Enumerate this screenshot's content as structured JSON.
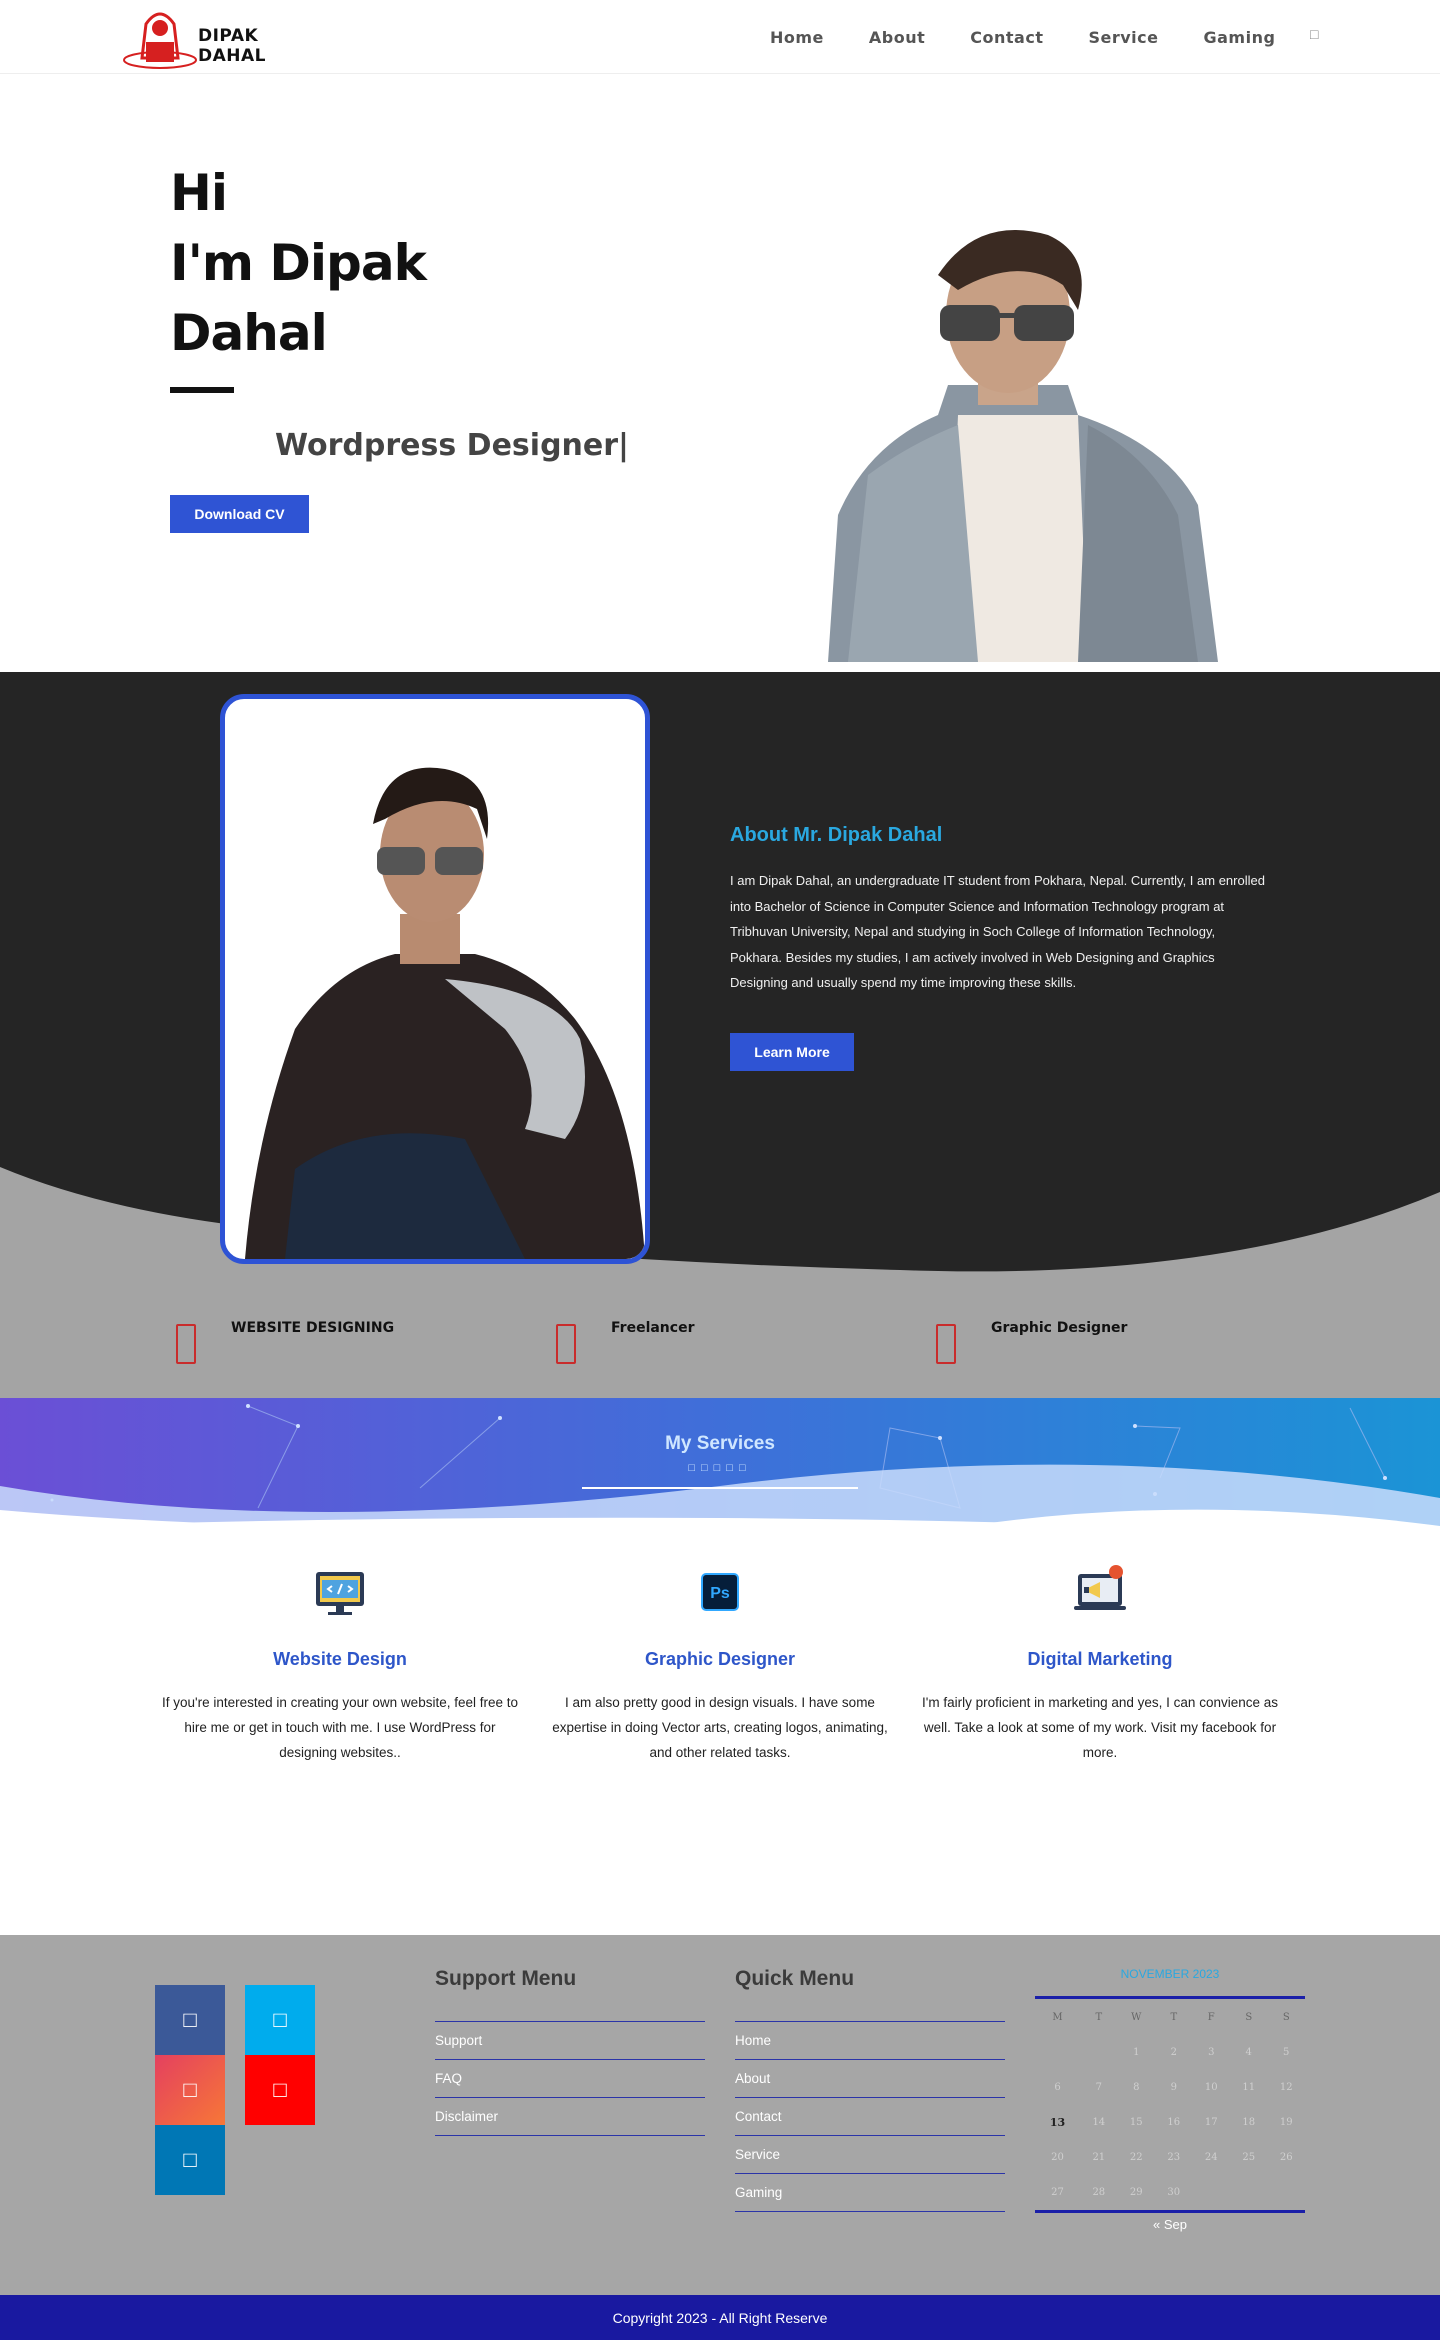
{
  "header": {
    "brand": "DIPAK DAHAL",
    "nav": [
      "Home",
      "About",
      "Contact",
      "Service",
      "Gaming"
    ]
  },
  "hero": {
    "line1": "Hi",
    "line2": "I'm Dipak",
    "line3": "Dahal",
    "subtitle": "Wordpress Designer|",
    "cta": "Download CV"
  },
  "about": {
    "heading": "About Mr. Dipak Dahal",
    "text": "I am Dipak Dahal, an undergraduate IT student from Pokhara, Nepal. Currently, I am enrolled into Bachelor of Science in Computer Science and Information Technology program at Tribhuvan University, Nepal and studying in Soch College of Information Technology, Pokhara. Besides my studies, I am actively involved in Web Designing and Graphics Designing and usually spend my time improving these skills.",
    "cta": "Learn More",
    "features": [
      "WEBSITE DESIGNING",
      "Freelancer",
      "Graphic Designer"
    ]
  },
  "services": {
    "title": "My Services",
    "items": [
      {
        "name": "Website Design",
        "desc": "If you're interested in creating your own website, feel free to hire me or get in touch with me. I use WordPress for designing websites.."
      },
      {
        "name": "Graphic Designer",
        "desc": "I am also pretty good in design visuals. I have some expertise in doing Vector arts, creating logos, animating, and other related tasks."
      },
      {
        "name": "Digital Marketing",
        "desc": "I'm fairly proficient in marketing and yes, I can convience as well. Take a look at some of my work. Visit my facebook for more."
      }
    ]
  },
  "footer": {
    "social": [
      {
        "icon": "facebook-icon",
        "color": "#3b5998"
      },
      {
        "icon": "twitter-icon",
        "color": "#00aced"
      },
      {
        "icon": "instagram-icon",
        "color": "#e4405f"
      },
      {
        "icon": "youtube-icon",
        "color": "#ff0000"
      },
      {
        "icon": "linkedin-icon",
        "color": "#0077b5"
      }
    ],
    "support_title": "Support Menu",
    "support_items": [
      "Support",
      "FAQ",
      "Disclaimer"
    ],
    "quick_title": "Quick Menu",
    "quick_items": [
      "Home",
      "About",
      "Contact",
      "Service",
      "Gaming"
    ],
    "calendar": {
      "caption": "NOVEMBER 2023",
      "weekdays": [
        "M",
        "T",
        "W",
        "T",
        "F",
        "S",
        "S"
      ],
      "weeks": [
        [
          "",
          "",
          "1",
          "2",
          "3",
          "4",
          "5"
        ],
        [
          "6",
          "7",
          "8",
          "9",
          "10",
          "11",
          "12"
        ],
        [
          "13",
          "14",
          "15",
          "16",
          "17",
          "18",
          "19"
        ],
        [
          "20",
          "21",
          "22",
          "23",
          "24",
          "25",
          "26"
        ],
        [
          "27",
          "28",
          "29",
          "30",
          "",
          "",
          ""
        ]
      ],
      "today": "13",
      "prev": "« Sep"
    },
    "copyright": "Copyright 2023 - All Right Reserve"
  }
}
